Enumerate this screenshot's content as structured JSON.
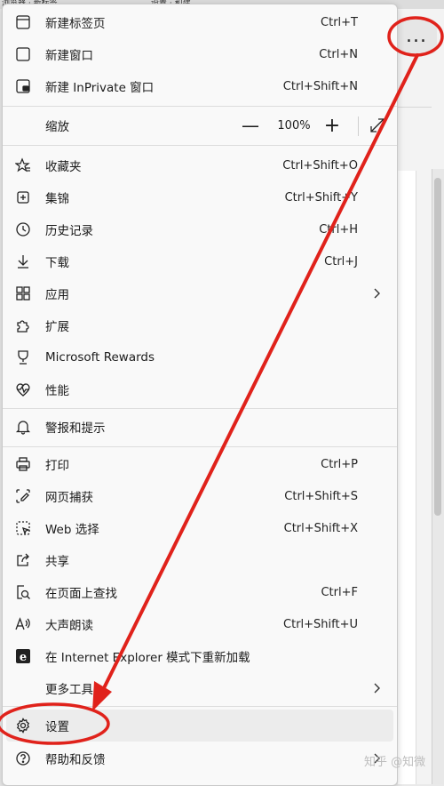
{
  "background": {
    "tab_1": "浏览器 · 新标签",
    "tab_2": "设置 · 和建"
  },
  "more_button": {
    "label": "..."
  },
  "menu": {
    "items": [
      {
        "label": "新建标签页",
        "shortcut": "Ctrl+T",
        "icon": "new-tab-icon"
      },
      {
        "label": "新建窗口",
        "shortcut": "Ctrl+N",
        "icon": "new-window-icon"
      },
      {
        "label": "新建 InPrivate 窗口",
        "shortcut": "Ctrl+Shift+N",
        "icon": "inprivate-icon"
      },
      {
        "label": "缩放",
        "icon": ""
      },
      {
        "label": "收藏夹",
        "shortcut": "Ctrl+Shift+O",
        "icon": "favorites-icon"
      },
      {
        "label": "集锦",
        "shortcut": "Ctrl+Shift+Y",
        "icon": "collections-icon"
      },
      {
        "label": "历史记录",
        "shortcut": "Ctrl+H",
        "icon": "history-icon"
      },
      {
        "label": "下载",
        "shortcut": "Ctrl+J",
        "icon": "download-icon"
      },
      {
        "label": "应用",
        "icon": "apps-icon"
      },
      {
        "label": "扩展",
        "icon": "extensions-icon"
      },
      {
        "label": "Microsoft Rewards",
        "icon": "rewards-icon"
      },
      {
        "label": "性能",
        "icon": "performance-icon"
      },
      {
        "label": "警报和提示",
        "icon": "bell-icon"
      },
      {
        "label": "打印",
        "shortcut": "Ctrl+P",
        "icon": "print-icon"
      },
      {
        "label": "网页捕获",
        "shortcut": "Ctrl+Shift+S",
        "icon": "capture-icon"
      },
      {
        "label": "Web 选择",
        "shortcut": "Ctrl+Shift+X",
        "icon": "web-select-icon"
      },
      {
        "label": "共享",
        "icon": "share-icon"
      },
      {
        "label": "在页面上查找",
        "shortcut": "Ctrl+F",
        "icon": "find-icon"
      },
      {
        "label": "大声朗读",
        "shortcut": "Ctrl+Shift+U",
        "icon": "read-aloud-icon"
      },
      {
        "label": "在 Internet Explorer 模式下重新加载",
        "icon": "ie-icon"
      },
      {
        "label": "更多工具",
        "icon": ""
      },
      {
        "label": "设置",
        "icon": "gear-icon"
      },
      {
        "label": "帮助和反馈",
        "icon": "help-icon"
      }
    ],
    "zoom": {
      "minus": "—",
      "value": "100%",
      "plus": "+"
    }
  },
  "watermark": "知乎 @知微",
  "colors": {
    "annotation": "#e0221b",
    "menu_bg": "#f9f9f9",
    "highlight": "#ececec"
  }
}
